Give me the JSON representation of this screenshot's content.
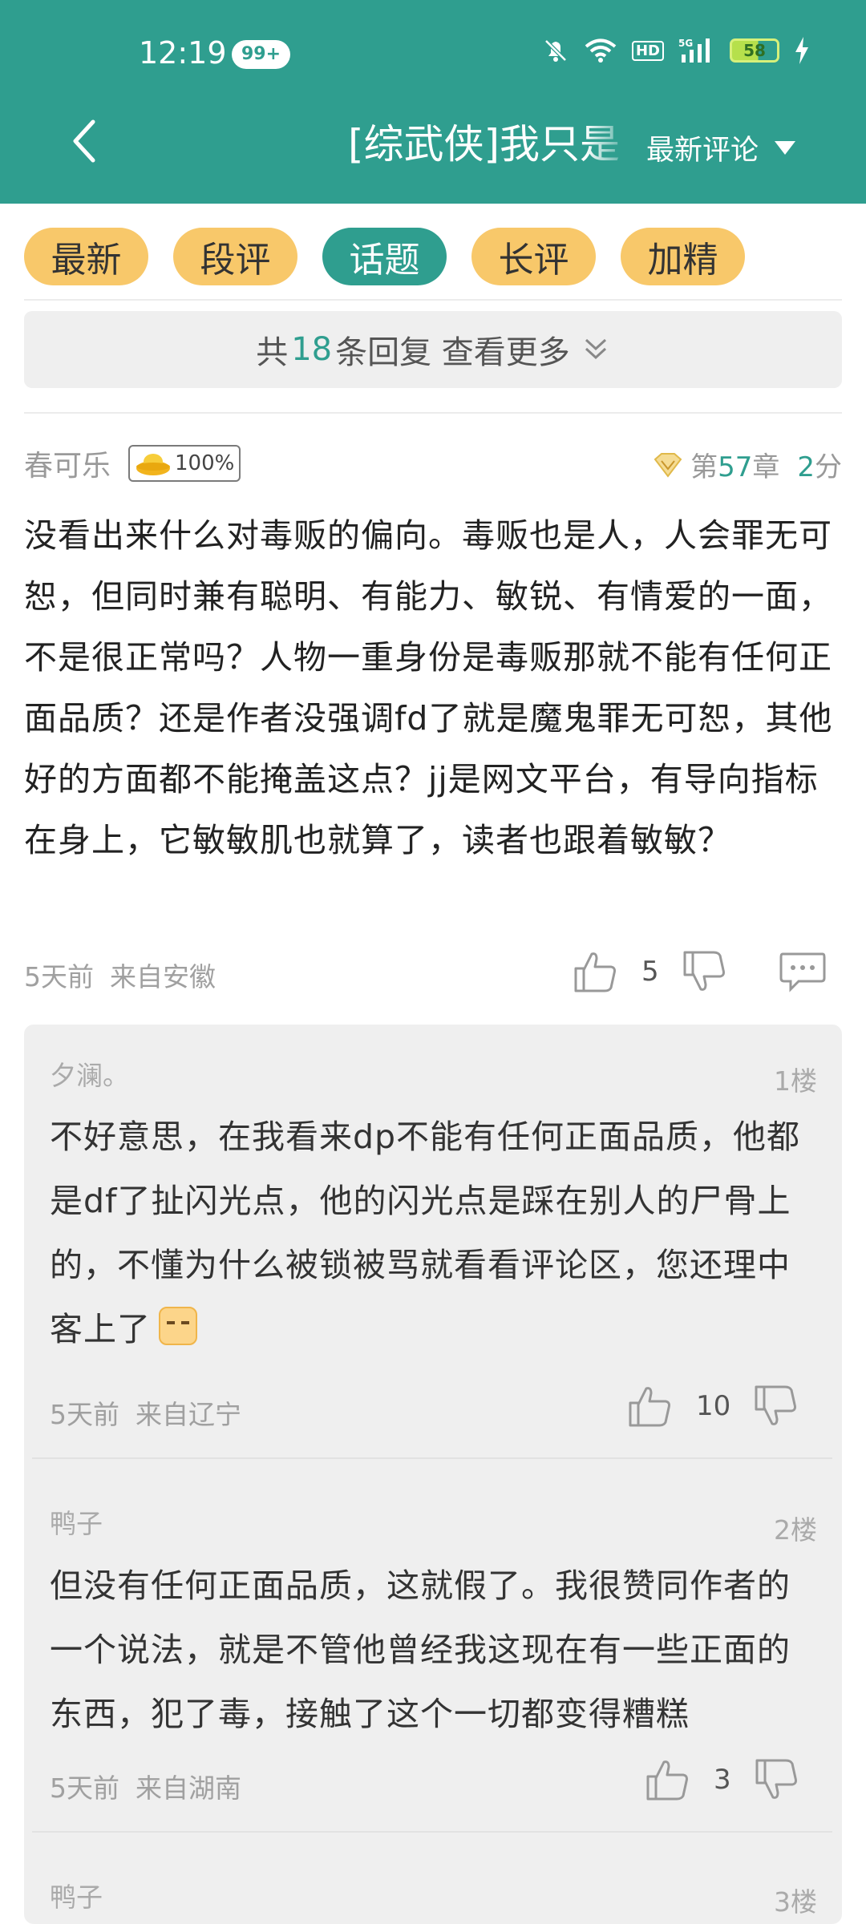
{
  "status_bar": {
    "time": "12:19",
    "notification_badge": "99+",
    "network_label": "HD",
    "battery": "58"
  },
  "navbar": {
    "title": "[综武侠]我只是",
    "sort_label": "最新评论"
  },
  "tabs": [
    {
      "label": "最新"
    },
    {
      "label": "段评"
    },
    {
      "label": "话题",
      "active": true
    },
    {
      "label": "长评"
    },
    {
      "label": "加精"
    }
  ],
  "more_replies": {
    "prefix": "共",
    "count": "18",
    "suffix": "条回复 查看更多"
  },
  "comment": {
    "author": "春可乐",
    "badge": "100%",
    "chapter_prefix": "第",
    "chapter_num": "57",
    "chapter_suffix": "章",
    "score_num": "2",
    "score_suffix": "分",
    "text": "没看出来什么对毒贩的偏向。毒贩也是人，人会罪无可恕，但同时兼有聪明、有能力、敏锐、有情爱的一面，不是很正常吗？人物一重身份是毒贩那就不能有任何正面品质？还是作者没强调fd了就是魔鬼罪无可恕，其他好的方面都不能掩盖这点？jj是网文平台，有导向指标在身上，它敏敏肌也就算了，读者也跟着敏敏？",
    "time": "5天前",
    "location": "来自安徽",
    "likes": "5"
  },
  "replies": [
    {
      "author": "夕澜。",
      "floor": "1楼",
      "text": "不好意思，在我看来dp不能有任何正面品质，他都是df了扯闪光点，他的闪光点是踩在别人的尸骨上的，不懂为什么被锁被骂就看看评论区，您还理中客上了",
      "time": "5天前",
      "location": "来自辽宁",
      "likes": "10"
    },
    {
      "author": "鸭子",
      "floor": "2楼",
      "text": "但没有任何正面品质，这就假了。我很赞同作者的一个说法，就是不管他曾经我这现在有一些正面的东西，犯了毒，接触了这个一切都变得糟糕",
      "time": "5天前",
      "location": "来自湖南",
      "likes": "3"
    },
    {
      "author": "鸭子",
      "floor": "3楼"
    }
  ],
  "colors": {
    "header": "#2f9e8f",
    "tab": "#f8c86a",
    "tab_active": "#2f9e8f"
  }
}
